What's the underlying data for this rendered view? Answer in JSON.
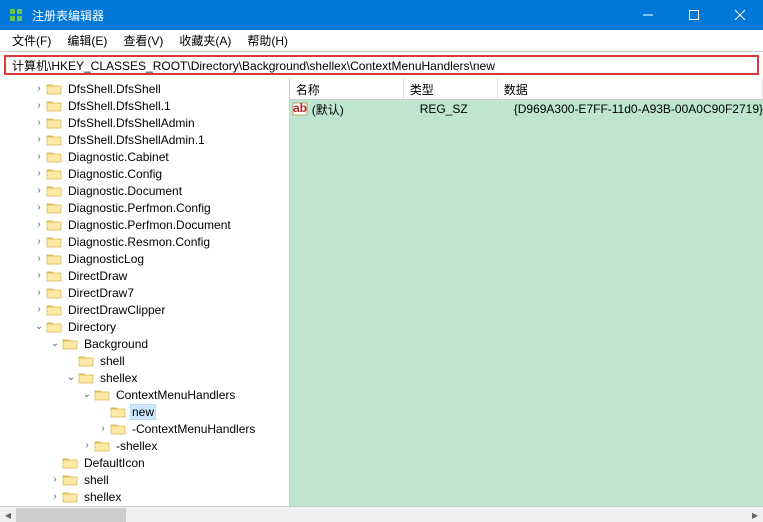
{
  "window": {
    "title": "注册表编辑器",
    "min_icon": "min",
    "max_icon": "max",
    "close_icon": "close"
  },
  "menu": {
    "file": "文件(F)",
    "edit": "编辑(E)",
    "view": "查看(V)",
    "fav": "收藏夹(A)",
    "help": "帮助(H)"
  },
  "address": "计算机\\HKEY_CLASSES_ROOT\\Directory\\Background\\shellex\\ContextMenuHandlers\\new",
  "tree": [
    {
      "indent": 2,
      "exp": ">",
      "label": "DfsShell.DfsShell"
    },
    {
      "indent": 2,
      "exp": ">",
      "label": "DfsShell.DfsShell.1"
    },
    {
      "indent": 2,
      "exp": ">",
      "label": "DfsShell.DfsShellAdmin"
    },
    {
      "indent": 2,
      "exp": ">",
      "label": "DfsShell.DfsShellAdmin.1"
    },
    {
      "indent": 2,
      "exp": ">",
      "label": "Diagnostic.Cabinet"
    },
    {
      "indent": 2,
      "exp": ">",
      "label": "Diagnostic.Config"
    },
    {
      "indent": 2,
      "exp": ">",
      "label": "Diagnostic.Document"
    },
    {
      "indent": 2,
      "exp": ">",
      "label": "Diagnostic.Perfmon.Config"
    },
    {
      "indent": 2,
      "exp": ">",
      "label": "Diagnostic.Perfmon.Document"
    },
    {
      "indent": 2,
      "exp": ">",
      "label": "Diagnostic.Resmon.Config"
    },
    {
      "indent": 2,
      "exp": ">",
      "label": "DiagnosticLog"
    },
    {
      "indent": 2,
      "exp": ">",
      "label": "DirectDraw"
    },
    {
      "indent": 2,
      "exp": ">",
      "label": "DirectDraw7"
    },
    {
      "indent": 2,
      "exp": ">",
      "label": "DirectDrawClipper"
    },
    {
      "indent": 2,
      "exp": "v",
      "label": "Directory"
    },
    {
      "indent": 3,
      "exp": "v",
      "label": "Background"
    },
    {
      "indent": 4,
      "exp": "",
      "label": "shell"
    },
    {
      "indent": 4,
      "exp": "v",
      "label": "shellex"
    },
    {
      "indent": 5,
      "exp": "v",
      "label": "ContextMenuHandlers"
    },
    {
      "indent": 6,
      "exp": "",
      "label": "new",
      "selected": true
    },
    {
      "indent": 6,
      "exp": ">",
      "label": "-ContextMenuHandlers"
    },
    {
      "indent": 5,
      "exp": ">",
      "label": "-shellex"
    },
    {
      "indent": 3,
      "exp": "",
      "label": "DefaultIcon"
    },
    {
      "indent": 3,
      "exp": ">",
      "label": "shell"
    },
    {
      "indent": 3,
      "exp": ">",
      "label": "shellex"
    }
  ],
  "columns": {
    "name": "名称",
    "type": "类型",
    "data": "数据"
  },
  "values": [
    {
      "name": "(默认)",
      "type": "REG_SZ",
      "data": "{D969A300-E7FF-11d0-A93B-00A0C90F2719}"
    }
  ]
}
